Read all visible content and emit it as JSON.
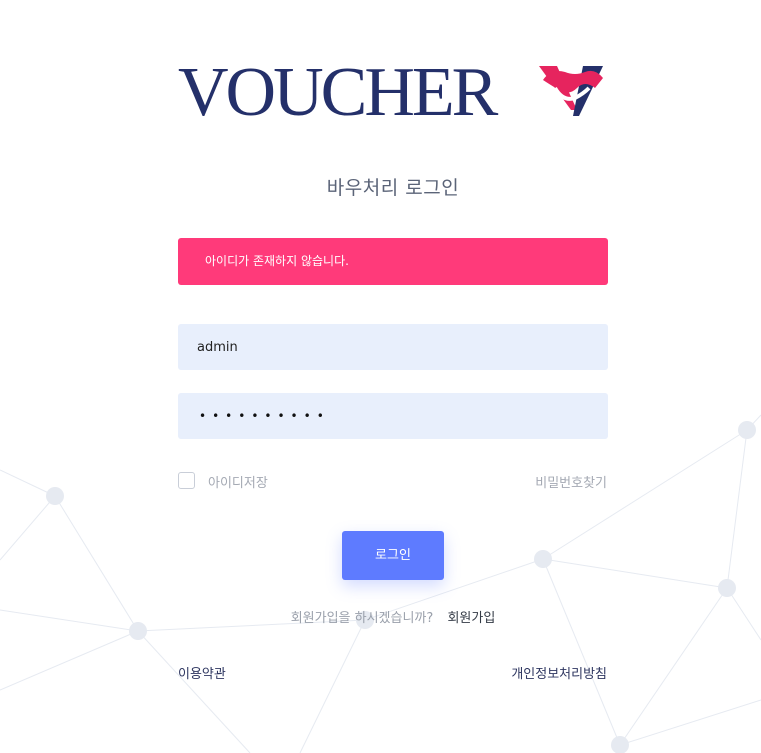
{
  "logo": {
    "text": "VOUCHER",
    "brand_color": "#24306a",
    "accent_color": "#e6245e"
  },
  "title": "바우처리 로그인",
  "alert": {
    "message": "아이디가 존재하지 않습니다.",
    "color": "#ff3a7a"
  },
  "form": {
    "id_value": "admin",
    "password_masked": "••••••••••",
    "remember_label": "아이디저장",
    "find_password": "비밀번호찾기",
    "login_button": "로그인"
  },
  "signup": {
    "question": "회원가입을 하시겠습니까?",
    "link": "회원가입"
  },
  "footer": {
    "terms": "이용약관",
    "privacy": "개인정보처리방침"
  },
  "colors": {
    "button": "#5e7bff",
    "input_bg": "#e8effc"
  }
}
